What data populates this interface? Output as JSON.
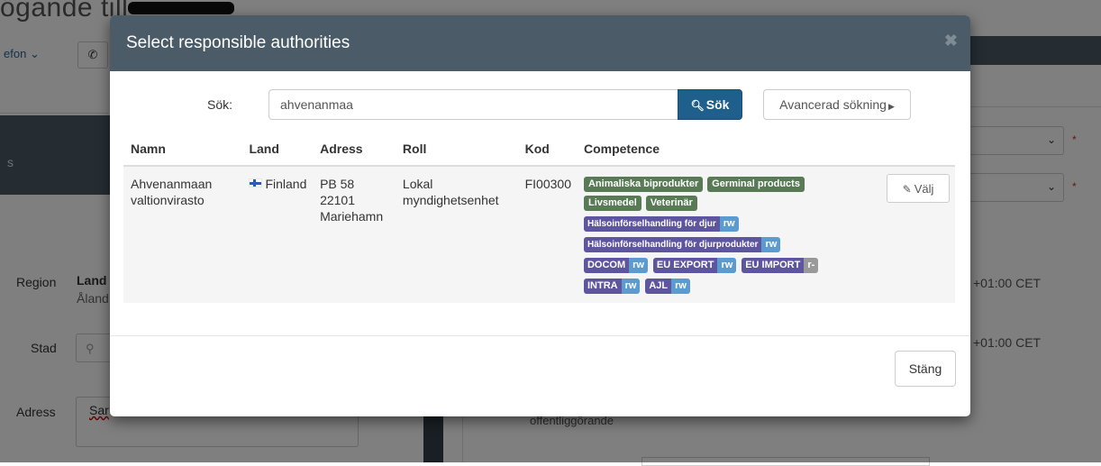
{
  "background": {
    "page_title": "ögande till",
    "telefon_label": "efon",
    "section_label": "s",
    "region_label": "Region",
    "region_value": "Land",
    "region_sub": "Åland",
    "stad_label": "Stad",
    "adress_label": "Adress",
    "adress_value": "Sar",
    "timezone_1": "+01:00 CET",
    "timezone_2": "+01:00 CET",
    "offentliggorande": "offentliggörande"
  },
  "modal": {
    "title": "Select responsible authorities",
    "close_symbol": "✖",
    "search": {
      "label": "Sök:",
      "value": "ahvenanmaa",
      "button_label": "Sök",
      "advanced_label": "Avancerad sökning"
    },
    "table": {
      "headers": [
        "Namn",
        "Land",
        "Adress",
        "Roll",
        "Kod",
        "Competence"
      ],
      "rows": [
        {
          "name_line1": "Ahvenanmaan",
          "name_line2": "valtionvirasto",
          "country": "Finland",
          "address_line1": "PB 58",
          "address_line2": "22101",
          "address_line3": "Mariehamn",
          "role_line1": "Lokal",
          "role_line2": "myndighetsenhet",
          "code": "FI00300",
          "competence_green": [
            "Animaliska biprodukter",
            "Germinal products",
            "Livsmedel",
            "Veterinär"
          ],
          "competence_rights": [
            {
              "name": "Hälsoinförselhandling för djur",
              "right": "rw"
            },
            {
              "name": "Hälsoinförselhandling för djurprodukter",
              "right": "rw"
            },
            {
              "name": "DOCOM",
              "right": "rw"
            },
            {
              "name": "EU EXPORT",
              "right": "rw"
            },
            {
              "name": "EU IMPORT",
              "right": "r-"
            },
            {
              "name": "INTRA",
              "right": "rw"
            },
            {
              "name": "AJL",
              "right": "rw"
            }
          ],
          "select_label": "Välj"
        }
      ]
    },
    "footer": {
      "close_label": "Stäng"
    }
  },
  "colors": {
    "header_bg": "#4b5c68",
    "primary_button": "#1f5f8b",
    "label_green": "#587b56",
    "label_purple": "#5e55a0",
    "label_blue": "#5b9bd0",
    "label_grey": "#999999"
  }
}
